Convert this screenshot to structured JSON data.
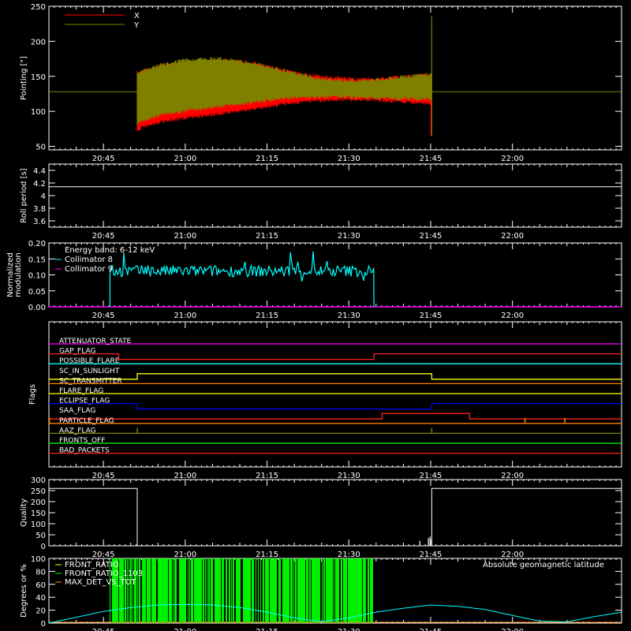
{
  "time_axis": {
    "start_min": 1235,
    "end_min": 1340,
    "tick_labels": [
      "20:45",
      "21:00",
      "21:15",
      "21:30",
      "21:45",
      "22:00"
    ],
    "tick_values": [
      1245,
      1260,
      1275,
      1290,
      1305,
      1320
    ]
  },
  "chart_data": [
    {
      "id": "pointing",
      "type": "line",
      "ylabel": "Pointing [\"]",
      "ylim": [
        45,
        250
      ],
      "yticks": [
        50,
        100,
        150,
        200,
        250
      ],
      "legend": [
        {
          "name": "X",
          "color": "#ff0000"
        },
        {
          "name": "Y",
          "color": "#808000"
        }
      ],
      "active_range": [
        1251.2,
        1305.2
      ],
      "baseline": 128,
      "envelope_x": {
        "x": [
          1251.2,
          1252,
          1256,
          1260,
          1264,
          1268,
          1272,
          1276,
          1280,
          1284,
          1288,
          1292,
          1296,
          1300,
          1305.2
        ],
        "upper": [
          158,
          162,
          168,
          172,
          175,
          176,
          172,
          165,
          158,
          153,
          150,
          149,
          150,
          152,
          155
        ],
        "lower": [
          68,
          75,
          83,
          88,
          92,
          96,
          100,
          105,
          110,
          113,
          114,
          114,
          113,
          111,
          108
        ]
      },
      "envelope_y": {
        "x": [
          1251.2,
          1252,
          1256,
          1260,
          1264,
          1268,
          1272,
          1276,
          1280,
          1284,
          1288,
          1292,
          1296,
          1300,
          1305.2
        ],
        "upper": [
          156,
          160,
          170,
          176,
          178,
          177,
          172,
          165,
          157,
          150,
          147,
          146,
          148,
          152,
          156
        ],
        "lower": [
          78,
          84,
          93,
          98,
          102,
          106,
          110,
          114,
          117,
          118,
          118,
          117,
          116,
          115,
          115
        ]
      },
      "spike": {
        "x": 1305.2,
        "max": 236,
        "min": 65
      }
    },
    {
      "id": "roll-period",
      "type": "line",
      "ylabel": "Roll period [s]",
      "ylim": [
        3.5,
        4.5
      ],
      "yticks": [
        3.6,
        3.8,
        4.0,
        4.2,
        4.4
      ],
      "series": [
        {
          "x": [
            1235,
            1340
          ],
          "y": [
            4.14,
            4.14
          ],
          "color": "#ffffff"
        }
      ]
    },
    {
      "id": "modulation",
      "type": "line",
      "ylabel": [
        "Normalized",
        "modulation"
      ],
      "ylim": [
        0,
        0.2
      ],
      "yticks": [
        0.0,
        0.05,
        0.1,
        0.15,
        0.2
      ],
      "ytick_labels": [
        "0.00",
        "0.05",
        "0.10",
        "0.15",
        "0.20"
      ],
      "legend_title": "Energy band: 6-12 keV",
      "legend": [
        {
          "name": "Collimator 8",
          "color": "#00ffff"
        },
        {
          "name": "Collimator 9",
          "color": "#ff00ff"
        }
      ],
      "collimator8_range": [
        1246.2,
        1294.6
      ],
      "collimator8_mean": 0.112,
      "collimator8_spread": 0.018,
      "collimator9_value": 0.0
    },
    {
      "id": "flags",
      "type": "line",
      "ylabel": "Flags",
      "rows": [
        {
          "name": "ATTENUATOR_STATE",
          "color": "#ff00ff",
          "steps": [
            [
              1235,
              0
            ],
            [
              1340,
              0
            ]
          ]
        },
        {
          "name": "GAP_FLAG",
          "color": "#ff2020",
          "steps": [
            [
              1235,
              0
            ],
            [
              1247.8,
              0
            ],
            [
              1247.8,
              -1
            ],
            [
              1294.6,
              -1
            ],
            [
              1294.6,
              0
            ],
            [
              1340,
              0
            ]
          ]
        },
        {
          "name": "POSSIBLE_FLARE",
          "color": "#00ffff",
          "steps": [
            [
              1235,
              0
            ],
            [
              1340,
              0
            ]
          ]
        },
        {
          "name": "SC_IN_SUNLIGHT",
          "color": "#ffff00",
          "steps": [
            [
              1235,
              -1
            ],
            [
              1251.2,
              -1
            ],
            [
              1251.2,
              0
            ],
            [
              1305.2,
              0
            ],
            [
              1305.2,
              -1
            ],
            [
              1340,
              -1
            ]
          ]
        },
        {
          "name": "SC_TRANSMITTER",
          "color": "#ff8000",
          "steps": [
            [
              1235,
              0
            ],
            [
              1340,
              0
            ]
          ]
        },
        {
          "name": "FLARE_FLAG",
          "color": "#ffff00",
          "steps": [
            [
              1235,
              0
            ],
            [
              1340,
              0
            ]
          ]
        },
        {
          "name": "ECLIPSE_FLAG",
          "color": "#0000ff",
          "steps": [
            [
              1235,
              0
            ],
            [
              1251.2,
              0
            ],
            [
              1251.2,
              -1
            ],
            [
              1305.2,
              -1
            ],
            [
              1305.2,
              0
            ],
            [
              1340,
              0
            ]
          ]
        },
        {
          "name": "SAA_FLAG",
          "color": "#ff2020",
          "steps": [
            [
              1235,
              -1
            ],
            [
              1296.1,
              -1
            ],
            [
              1296.1,
              0
            ],
            [
              1312.1,
              0
            ],
            [
              1312.1,
              -1
            ],
            [
              1340,
              -1
            ]
          ]
        },
        {
          "name": "PARTICLE_FLAG",
          "color": "#ff8000",
          "steps": [
            [
              1235,
              0
            ],
            [
              1340,
              0
            ]
          ],
          "ticks": [
            1235.1,
            1322.3,
            1329.6
          ]
        },
        {
          "name": "AAZ_FLAG",
          "color": "#808000",
          "steps": [
            [
              1235,
              0
            ],
            [
              1340,
              0
            ]
          ],
          "ticks": [
            1251.2,
            1305.2
          ]
        },
        {
          "name": "FRONTS_OFF",
          "color": "#00ff00",
          "steps": [
            [
              1235,
              0
            ],
            [
              1340,
              0
            ]
          ]
        },
        {
          "name": "BAD_PACKETS",
          "color": "#ff2020",
          "steps": [
            [
              1235,
              0
            ],
            [
              1340,
              0
            ]
          ]
        }
      ]
    },
    {
      "id": "quality",
      "type": "line",
      "ylabel": "Quality",
      "ylim": [
        0,
        300
      ],
      "yticks": [
        0,
        50,
        100,
        150,
        200,
        250,
        300
      ],
      "series": [
        {
          "x": [
            1235,
            1251.2,
            1251.2,
            1305.2,
            1305.2,
            1340
          ],
          "y": [
            260,
            260,
            0,
            0,
            260,
            260
          ],
          "color": "#ffffff"
        }
      ],
      "spikes": [
        {
          "x": 1303.0,
          "y": 22
        },
        {
          "x": 1304.6,
          "y": 35
        },
        {
          "x": 1304.9,
          "y": 42
        }
      ]
    },
    {
      "id": "front-ratio",
      "type": "line",
      "ylabel": "Degrees or %",
      "ylim": [
        0,
        100
      ],
      "yticks": [
        0,
        20,
        40,
        60,
        80,
        100
      ],
      "legend": [
        {
          "name": "FRONT_RATIO",
          "color": "#ffff00"
        },
        {
          "name": "FRONT_RATIO_1103",
          "color": "#00ff00"
        },
        {
          "name": "MAX_DET_VS_TOT",
          "color": "#ff8000"
        }
      ],
      "right_label": "Absolute geomagnetic latitude",
      "right_label_color": "#00ffff",
      "green_range": [
        1246.2,
        1294.6
      ],
      "latitude": {
        "x": [
          1235,
          1240,
          1245,
          1250,
          1255,
          1260,
          1265,
          1270,
          1275,
          1280,
          1285,
          1290,
          1295,
          1300,
          1305,
          1310,
          1315,
          1320,
          1325,
          1330,
          1335,
          1340
        ],
        "y": [
          0,
          9,
          18,
          24,
          28,
          29,
          28,
          24,
          17,
          8,
          2,
          8,
          17,
          23,
          28,
          26,
          21,
          12,
          3,
          2,
          10,
          17
        ]
      }
    }
  ]
}
